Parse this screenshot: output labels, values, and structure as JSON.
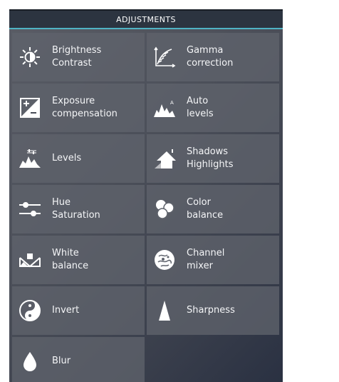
{
  "header": {
    "title": "ADJUSTMENTS"
  },
  "tiles": [
    {
      "line1": "Brightness",
      "line2": "Contrast",
      "icon": "sun-icon"
    },
    {
      "line1": "Gamma",
      "line2": "correction",
      "icon": "gamma-curve-icon"
    },
    {
      "line1": "Exposure",
      "line2": "compensation",
      "icon": "exposure-plus-minus-icon"
    },
    {
      "line1": "Auto",
      "line2": "levels",
      "icon": "auto-levels-histogram-icon"
    },
    {
      "line1": "Levels",
      "line2": "",
      "icon": "levels-histogram-icon"
    },
    {
      "line1": "Shadows",
      "line2": "Highlights",
      "icon": "house-shadow-icon"
    },
    {
      "line1": "Hue",
      "line2": "Saturation",
      "icon": "sliders-icon"
    },
    {
      "line1": "Color",
      "line2": "balance",
      "icon": "color-circles-icon"
    },
    {
      "line1": "White",
      "line2": "balance",
      "icon": "white-balance-icon"
    },
    {
      "line1": "Channel",
      "line2": "mixer",
      "icon": "channel-mixer-icon"
    },
    {
      "line1": "Invert",
      "line2": "",
      "icon": "yin-yang-icon"
    },
    {
      "line1": "Sharpness",
      "line2": "",
      "icon": "triangle-sharpness-icon"
    },
    {
      "line1": "Blur",
      "line2": "",
      "icon": "drop-icon"
    }
  ],
  "colors": {
    "accent": "#4fb3c4",
    "tile": "#5f636c",
    "text": "#f4f5f7"
  }
}
